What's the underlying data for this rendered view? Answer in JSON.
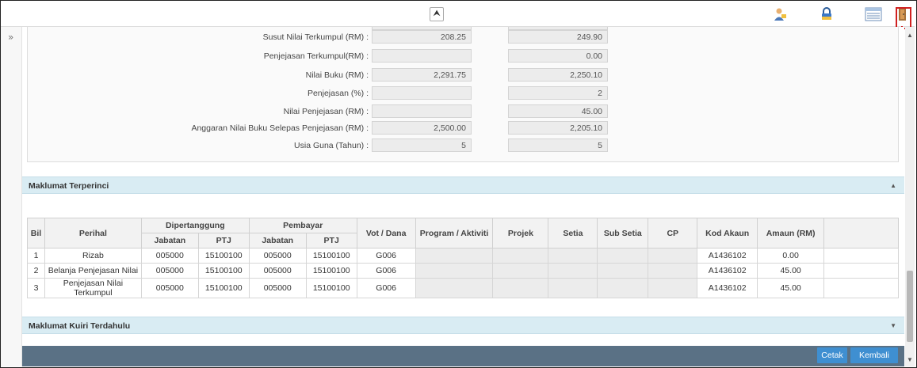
{
  "toolbar": {
    "collapse_glyph": "⮝",
    "icons": [
      "user-support-icon",
      "lock-icon",
      "table-view-icon",
      "exit-door-icon"
    ]
  },
  "sidebar": {
    "expand_glyph": "»"
  },
  "summary_fields": [
    {
      "label": "Susut Nilai Terkumpul (RM) :",
      "col1": "208.25",
      "col2": "249.90"
    },
    {
      "label": "Penjejasan Terkumpul(RM) :",
      "col1": "",
      "col2": "0.00"
    },
    {
      "label": "Nilai Buku (RM) :",
      "col1": "2,291.75",
      "col2": "2,250.10"
    },
    {
      "label": "Penjejasan (%) :",
      "col1": "",
      "col2": "2"
    },
    {
      "label": "Nilai Penjejasan (RM) :",
      "col1": "",
      "col2": "45.00"
    },
    {
      "label": "Anggaran Nilai Buku Selepas Penjejasan (RM) :",
      "col1": "2,500.00",
      "col2": "2,205.10"
    },
    {
      "label": "Usia Guna (Tahun) :",
      "col1": "5",
      "col2": "5"
    }
  ],
  "section_details": {
    "title": "Maklumat Terperinci",
    "chevron": "▲"
  },
  "section_history": {
    "title": "Maklumat Kuiri Terdahulu",
    "chevron": "▼"
  },
  "table": {
    "headers": {
      "bil": "Bil",
      "perihal": "Perihal",
      "dipertanggung": "Dipertanggung",
      "pembayar": "Pembayar",
      "jabatan": "Jabatan",
      "ptj": "PTJ",
      "vot": "Vot / Dana",
      "program": "Program / Aktiviti",
      "projek": "Projek",
      "setia": "Setia",
      "subsetia": "Sub Setia",
      "cp": "CP",
      "kod": "Kod Akaun",
      "amaun": "Amaun (RM)"
    },
    "rows": [
      {
        "bil": "1",
        "perihal": "Rizab",
        "jab1": "005000",
        "ptj1": "15100100",
        "jab2": "005000",
        "ptj2": "15100100",
        "vot": "G006",
        "kod": "A1436102",
        "amaun": "0.00"
      },
      {
        "bil": "2",
        "perihal": "Belanja Penjejasan Nilai",
        "jab1": "005000",
        "ptj1": "15100100",
        "jab2": "005000",
        "ptj2": "15100100",
        "vot": "G006",
        "kod": "A1436102",
        "amaun": "45.00"
      },
      {
        "bil": "3",
        "perihal": "Penjejasan Nilai Terkumpul",
        "jab1": "005000",
        "ptj1": "15100100",
        "jab2": "005000",
        "ptj2": "15100100",
        "vot": "G006",
        "kod": "A1436102",
        "amaun": "45.00"
      }
    ]
  },
  "buttons": {
    "print": "Cetak",
    "back": "Kembali"
  },
  "callout": {
    "number": "1"
  },
  "colors": {
    "accent": "#3f8fd1",
    "section_header": "#d9ecf3",
    "footer": "#5a7185",
    "callout": "#d02020"
  }
}
